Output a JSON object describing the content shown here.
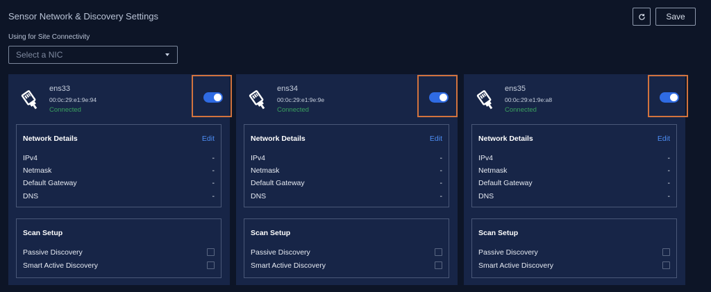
{
  "header": {
    "title": "Sensor Network & Discovery Settings",
    "refresh_icon": "refresh-icon",
    "save_label": "Save"
  },
  "nic_selector": {
    "label": "Using for Site Connectivity",
    "placeholder": "Select a NIC",
    "caret_icon": "caret-down-icon"
  },
  "cards": [
    {
      "name": "ens33",
      "mac": "00:0c:29:e1:9e:94",
      "status": "Connected",
      "enabled": true,
      "details_title": "Network Details",
      "edit_label": "Edit",
      "details": [
        {
          "label": "IPv4",
          "value": "-"
        },
        {
          "label": "Netmask",
          "value": "-"
        },
        {
          "label": "Default Gateway",
          "value": "-"
        },
        {
          "label": "DNS",
          "value": "-"
        }
      ],
      "scan_title": "Scan Setup",
      "scan_options": [
        {
          "label": "Passive Discovery",
          "checked": false
        },
        {
          "label": "Smart Active Discovery",
          "checked": false
        }
      ]
    },
    {
      "name": "ens34",
      "mac": "00:0c:29:e1:9e:9e",
      "status": "Connected",
      "enabled": true,
      "details_title": "Network Details",
      "edit_label": "Edit",
      "details": [
        {
          "label": "IPv4",
          "value": "-"
        },
        {
          "label": "Netmask",
          "value": "-"
        },
        {
          "label": "Default Gateway",
          "value": "-"
        },
        {
          "label": "DNS",
          "value": "-"
        }
      ],
      "scan_title": "Scan Setup",
      "scan_options": [
        {
          "label": "Passive Discovery",
          "checked": false
        },
        {
          "label": "Smart Active Discovery",
          "checked": false
        }
      ]
    },
    {
      "name": "ens35",
      "mac": "00:0c:29:e1:9e:a8",
      "status": "Connected",
      "enabled": true,
      "details_title": "Network Details",
      "edit_label": "Edit",
      "details": [
        {
          "label": "IPv4",
          "value": "-"
        },
        {
          "label": "Netmask",
          "value": "-"
        },
        {
          "label": "Default Gateway",
          "value": "-"
        },
        {
          "label": "DNS",
          "value": "-"
        }
      ],
      "scan_title": "Scan Setup",
      "scan_options": [
        {
          "label": "Passive Discovery",
          "checked": false
        },
        {
          "label": "Smart Active Discovery",
          "checked": false
        }
      ]
    }
  ],
  "colors": {
    "background": "#0d1527",
    "card": "#172547",
    "accent": "#2f6be3",
    "link": "#4d8ef5",
    "connected": "#3aa05f",
    "highlight": "#d2733e"
  }
}
